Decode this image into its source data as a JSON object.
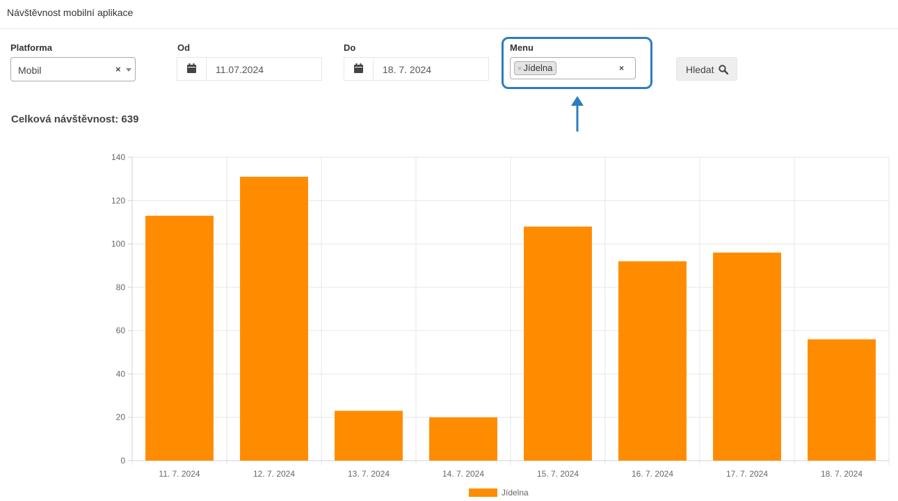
{
  "header": {
    "title": "Návštěvnost mobilní aplikace"
  },
  "filters": {
    "platform": {
      "label": "Platforma",
      "value": "Mobil",
      "clear_icon": "×"
    },
    "from": {
      "label": "Od",
      "value": "11.07.2024",
      "icon": "calendar-icon"
    },
    "to": {
      "label": "Do",
      "value": "18. 7. 2024",
      "icon": "calendar-icon"
    },
    "menu": {
      "label": "Menu",
      "tag_remove": "×",
      "tag": "Jídelna",
      "clear_icon": "×",
      "highlight_color": "#2b7cc2"
    },
    "search_button": {
      "label": "Hledat",
      "icon": "search-icon"
    }
  },
  "summary": {
    "total_label": "Celková návštěvnost: 639"
  },
  "chart_data": {
    "type": "bar",
    "categories": [
      "11. 7. 2024",
      "12. 7. 2024",
      "13. 7. 2024",
      "14. 7. 2024",
      "15. 7. 2024",
      "16. 7. 2024",
      "17. 7. 2024",
      "18. 7. 2024"
    ],
    "series": [
      {
        "name": "Jídelna",
        "color": "#ff8c00",
        "values": [
          113,
          131,
          23,
          20,
          108,
          92,
          96,
          56
        ]
      }
    ],
    "ylim": [
      0,
      140
    ],
    "yticks": [
      0,
      20,
      40,
      60,
      80,
      100,
      120,
      140
    ],
    "grid": true,
    "legend": "bottom"
  }
}
